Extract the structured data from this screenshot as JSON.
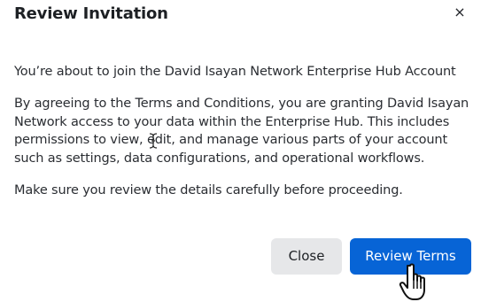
{
  "dialog": {
    "title": "Review Invitation",
    "close_symbol": "×",
    "intro": "You’re about to join the David Isayan Network Enterprise Hub Account",
    "details": "By agreeing to the Terms and Conditions, you are granting David Isayan Network access to your data within the Enterprise Hub. This includes permissions to view, edit, and manage various parts of your account such as settings, data configurations, and operational workflows.",
    "reminder": "Make sure you review the details carefully before proceeding.",
    "close_button_label": "Close",
    "review_button_label": "Review Terms"
  },
  "icons": {
    "close": "close-icon",
    "text_cursor": "i-beam-cursor-icon",
    "pointer": "hand-pointer-cursor-icon"
  },
  "colors": {
    "primary_button": "#0764d6",
    "secondary_button": "#e6e7e9",
    "text": "#1d2024"
  }
}
